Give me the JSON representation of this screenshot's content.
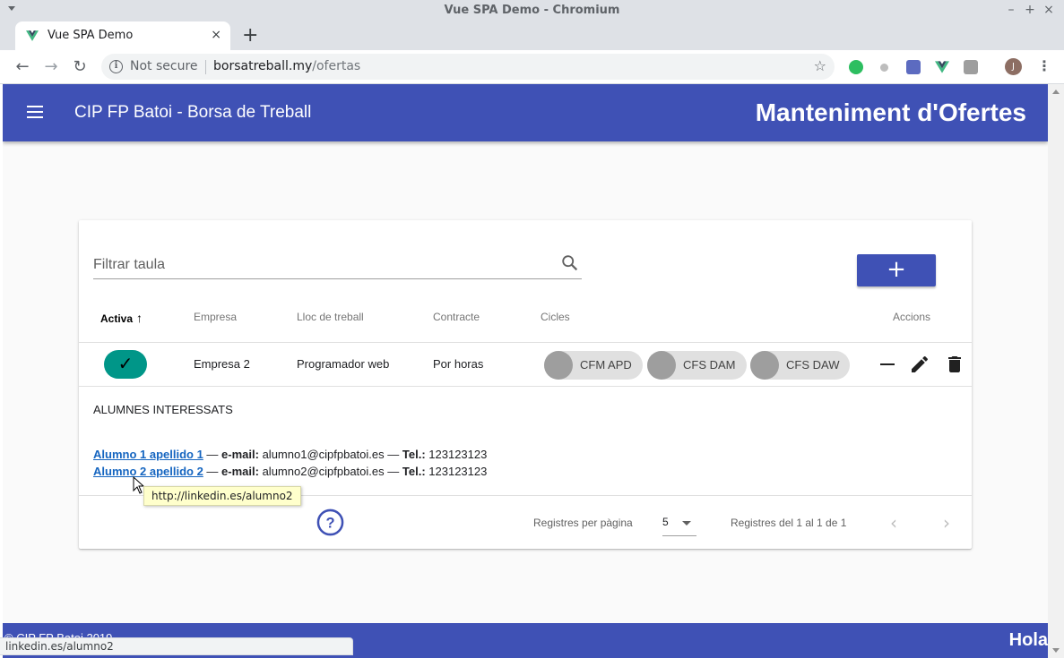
{
  "window": {
    "title": "Vue SPA Demo - Chromium",
    "minimize": "–",
    "maximize": "+",
    "close": "×"
  },
  "tab": {
    "title": "Vue SPA Demo",
    "close": "×",
    "new_tab": "+"
  },
  "address_bar": {
    "security_label": "Not secure",
    "url_host": "borsatreball.my",
    "url_path": "/ofertas",
    "profile_initial": "J"
  },
  "app": {
    "title": "CIP FP Batoi - Borsa de Treball",
    "page_heading": "Manteniment d'Ofertes",
    "brand_color": "#3f51b5"
  },
  "filter": {
    "placeholder": "Filtrar taula",
    "value": ""
  },
  "add_button": {
    "label": "+"
  },
  "table": {
    "headers": {
      "active": "Activa",
      "company": "Empresa",
      "location": "Lloc de treball",
      "contract": "Contracte",
      "cycles": "Cicles",
      "actions": "Accions"
    },
    "sort_indicator": "↑",
    "rows": [
      {
        "active_icon": "✓",
        "company": "Empresa 2",
        "location": "Programador web",
        "contract": "Por horas",
        "cycles": [
          "CFM APD",
          "CFS DAM",
          "CFS DAW"
        ]
      }
    ]
  },
  "expanded": {
    "title": "ALUMNES INTERESSATS",
    "email_label": "e-mail:",
    "tel_label": "Tel.:",
    "dash": "—",
    "students": [
      {
        "name": "Alumno 1 apellido 1",
        "email": "alumno1@cipfpbatoi.es",
        "tel": "123123123"
      },
      {
        "name": "Alumno 2 apellido 2",
        "email": "alumno2@cipfpbatoi.es",
        "tel": "123123123"
      }
    ],
    "tooltip": "http://linkedin.es/alumno2"
  },
  "pagination": {
    "rows_per_page_label": "Registres per pàgina",
    "rows_per_page": "5",
    "range": "Registres del 1 al 1 de 1",
    "prev": "‹",
    "next": "›"
  },
  "footer": {
    "copyright": "© CIP FP Batoi 2019",
    "greeting": "Hola"
  },
  "statusbar": {
    "text": "linkedin.es/alumno2"
  }
}
